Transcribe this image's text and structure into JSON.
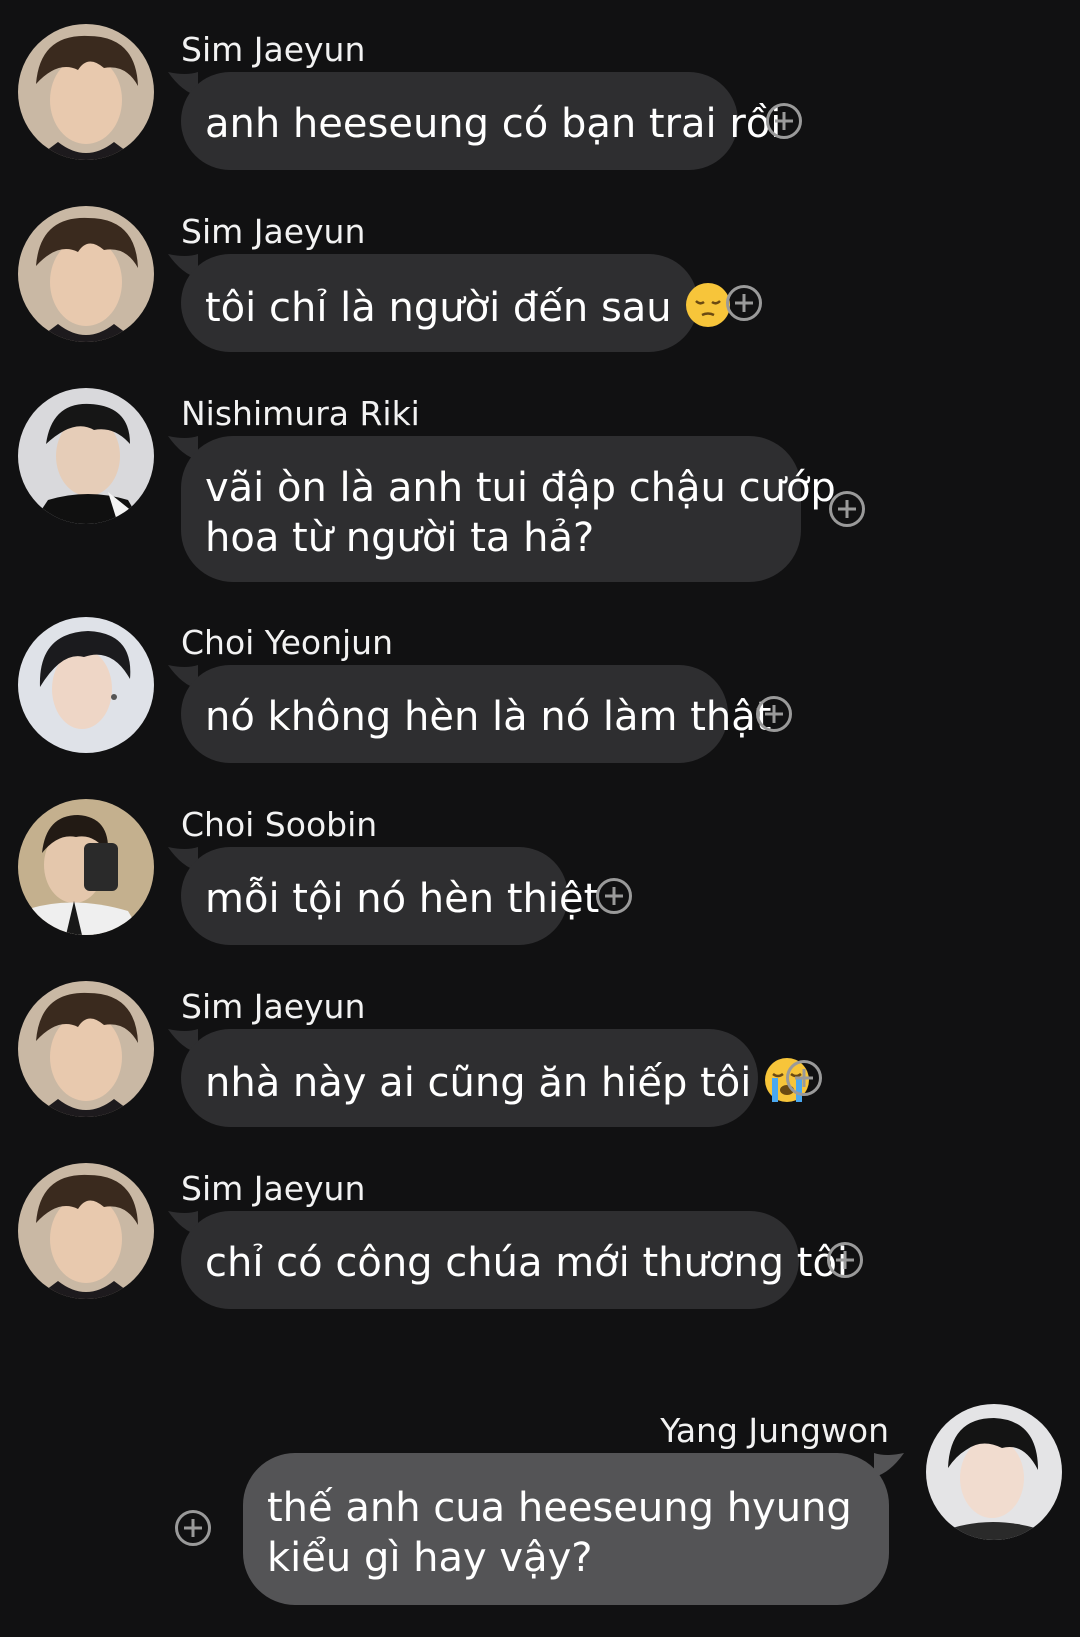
{
  "messages": [
    {
      "sender": "Sim Jaeyun",
      "lines": [
        "anh heeseung có bạn trai rồi"
      ],
      "emoji": "",
      "avatar_icon": "avatar-jaeyun"
    },
    {
      "sender": "Sim Jaeyun",
      "lines": [
        "tôi chỉ là người đến sau"
      ],
      "emoji": "pensive-face",
      "avatar_icon": "avatar-jaeyun"
    },
    {
      "sender": "Nishimura Riki",
      "lines": [
        "vãi òn là anh tui đập chậu cướp",
        "hoa từ người ta hả?"
      ],
      "emoji": "",
      "avatar_icon": "avatar-riki"
    },
    {
      "sender": "Choi Yeonjun",
      "lines": [
        "nó không hèn là nó làm thật"
      ],
      "emoji": "",
      "avatar_icon": "avatar-yeonjun"
    },
    {
      "sender": "Choi Soobin",
      "lines": [
        "mỗi tội nó hèn thiệt"
      ],
      "emoji": "",
      "avatar_icon": "avatar-soobin"
    },
    {
      "sender": "Sim Jaeyun",
      "lines": [
        "nhà này ai cũng ăn hiếp tôi"
      ],
      "emoji": "loudly-crying-face",
      "avatar_icon": "avatar-jaeyun"
    },
    {
      "sender": "Sim Jaeyun",
      "lines": [
        "chỉ có công chúa mới thương tôi"
      ],
      "emoji": "",
      "avatar_icon": "avatar-jaeyun"
    },
    {
      "sender": "Yang Jungwon",
      "lines": [
        "thế anh cua heeseung hyung",
        "kiểu gì hay vậy?"
      ],
      "emoji": "",
      "avatar_icon": "avatar-jungwon",
      "outgoing": true
    }
  ],
  "icons": {
    "reaction": "add-reaction-icon"
  },
  "colors": {
    "background": "#111112",
    "incoming_bubble": "#2e2e30",
    "outgoing_bubble": "#545456",
    "reaction_icon": "#9a9a9a"
  }
}
